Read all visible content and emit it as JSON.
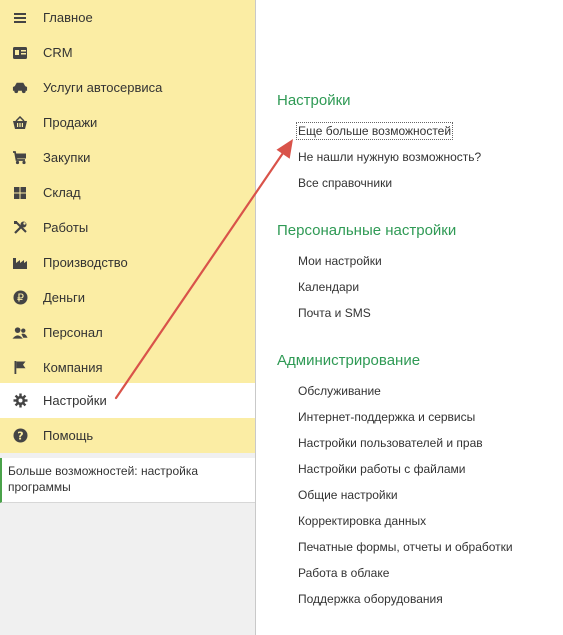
{
  "sidebar": {
    "items": [
      {
        "label": "Главное",
        "icon": "menu-icon"
      },
      {
        "label": "CRM",
        "icon": "crm-icon"
      },
      {
        "label": "Услуги автосервиса",
        "icon": "car-icon"
      },
      {
        "label": "Продажи",
        "icon": "basket-icon"
      },
      {
        "label": "Закупки",
        "icon": "cart-icon"
      },
      {
        "label": "Склад",
        "icon": "warehouse-icon"
      },
      {
        "label": "Работы",
        "icon": "tools-icon"
      },
      {
        "label": "Производство",
        "icon": "factory-icon"
      },
      {
        "label": "Деньги",
        "icon": "ruble-icon"
      },
      {
        "label": "Персонал",
        "icon": "people-icon"
      },
      {
        "label": "Компания",
        "icon": "flag-icon"
      },
      {
        "label": "Настройки",
        "icon": "gear-icon",
        "active": true
      },
      {
        "label": "Помощь",
        "icon": "help-icon"
      }
    ],
    "hint": "Больше возможностей: настройка программы"
  },
  "content": {
    "sections": [
      {
        "title": "Настройки",
        "links": [
          "Еще больше возможностей",
          "Не нашли нужную возможность?",
          "Все справочники"
        ]
      },
      {
        "title": "Персональные настройки",
        "links": [
          "Мои настройки",
          "Календари",
          "Почта и SMS"
        ]
      },
      {
        "title": "Администрирование",
        "links": [
          "Обслуживание",
          "Интернет-поддержка и сервисы",
          "Настройки пользователей и прав",
          "Настройки работы с файлами",
          "Общие настройки",
          "Корректировка данных",
          "Печатные формы, отчеты и обработки",
          "Работа в облаке",
          "Поддержка оборудования"
        ]
      }
    ]
  },
  "colors": {
    "sidebar_bg": "#fbeda4",
    "section_title": "#2f9a55",
    "annotation_arrow": "#d9534a"
  }
}
